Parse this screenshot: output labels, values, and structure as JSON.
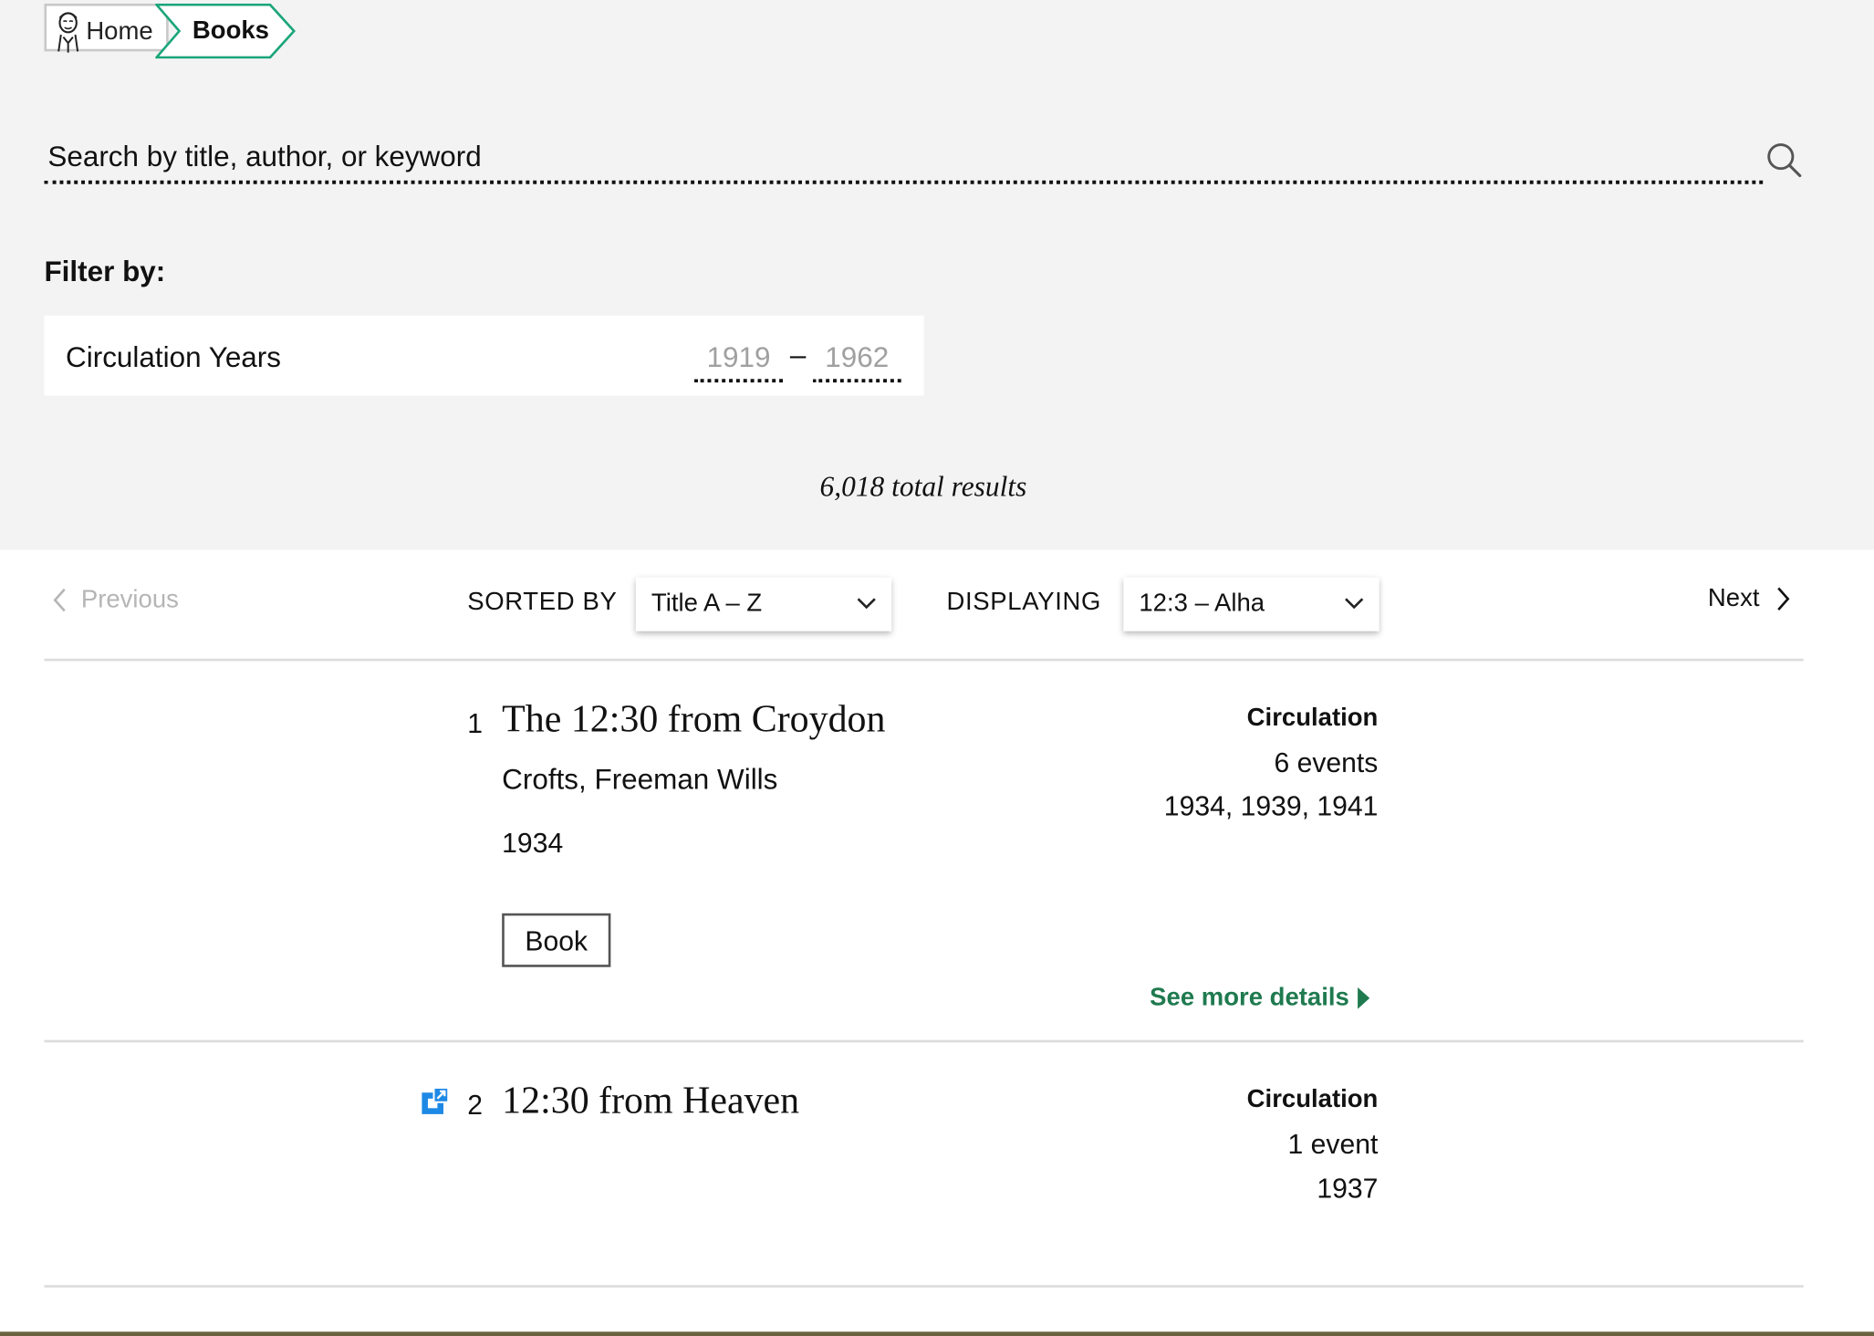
{
  "breadcrumb": {
    "home_label": "Home",
    "current_label": "Books",
    "accent_color": "#1aa57a"
  },
  "search": {
    "placeholder": "Search by title, author, or keyword",
    "value": ""
  },
  "filter": {
    "title": "Filter by:",
    "circulation_label": "Circulation Years",
    "year_start_placeholder": "1919",
    "year_end_placeholder": "1962",
    "year_separator": "–"
  },
  "results_summary": "6,018 total results",
  "controls": {
    "previous_label": "Previous",
    "next_label": "Next",
    "sorted_by_label": "SORTED BY",
    "sort_value": "Title A – Z",
    "displaying_label": "DISPLAYING",
    "display_value": "12:3 – Alha"
  },
  "results": [
    {
      "number": "1",
      "title": "The 12:30 from Croydon",
      "author": "Crofts, Freeman Wills",
      "year": "1934",
      "format": "Book",
      "circulation_heading": "Circulation",
      "events": "6 events",
      "years": "1934, 1939, 1941",
      "details_label": "See more details"
    },
    {
      "number": "2",
      "title": "12:30 from Heaven",
      "circulation_heading": "Circulation",
      "events": "1 event",
      "years": "1937",
      "has_external_icon": true
    }
  ],
  "colors": {
    "top_band": "#f3f3f3",
    "link_green": "#1f7a4f",
    "external_icon_blue": "#1e88e5"
  }
}
